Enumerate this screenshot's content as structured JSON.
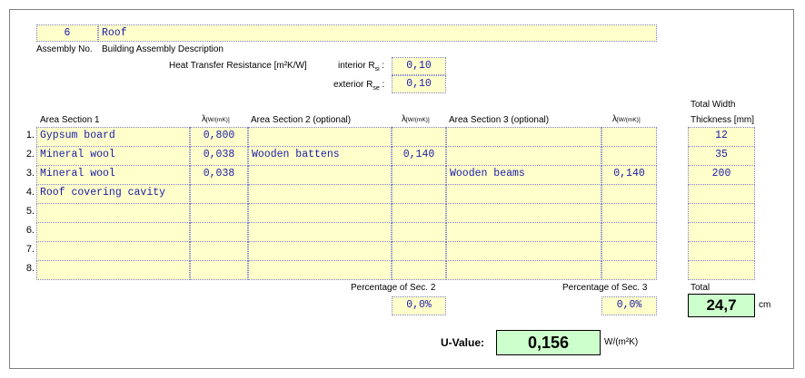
{
  "assembly": {
    "number": "6",
    "description": "Roof",
    "number_label": "Assembly No.",
    "description_label": "Building Assembly Description"
  },
  "heat_transfer": {
    "label": "Heat Transfer Resistance [m²K/W]",
    "interior_label": "interior R",
    "interior_sub": "si",
    "interior_value": "0,10",
    "exterior_label": "exterior R",
    "exterior_sub": "se",
    "exterior_value": "0,10"
  },
  "headers": {
    "area1": "Area Section 1",
    "area2": "Area Section 2 (optional)",
    "area3": "Area Section 3 (optional)",
    "lambda": "λ",
    "lambda_unit": "[W/(mK)]",
    "total_width": "Total Width",
    "thickness": "Thickness [mm]"
  },
  "rows": [
    {
      "num": "1.",
      "m1": "Gypsum board",
      "l1": "0,800",
      "m2": "",
      "l2": "",
      "m3": "",
      "l3": "",
      "thickness": "12"
    },
    {
      "num": "2.",
      "m1": "Mineral wool",
      "l1": "0,038",
      "m2": "Wooden battens",
      "l2": "0,140",
      "m3": "",
      "l3": "",
      "thickness": "35"
    },
    {
      "num": "3.",
      "m1": "Mineral wool",
      "l1": "0,038",
      "m2": "",
      "l2": "",
      "m3": "Wooden beams",
      "l3": "0,140",
      "thickness": "200"
    },
    {
      "num": "4.",
      "m1": "Roof covering cavity",
      "l1": "",
      "m2": "",
      "l2": "",
      "m3": "",
      "l3": "",
      "thickness": ""
    },
    {
      "num": "5.",
      "m1": "",
      "l1": "",
      "m2": "",
      "l2": "",
      "m3": "",
      "l3": "",
      "thickness": ""
    },
    {
      "num": "6.",
      "m1": "",
      "l1": "",
      "m2": "",
      "l2": "",
      "m3": "",
      "l3": "",
      "thickness": ""
    },
    {
      "num": "7.",
      "m1": "",
      "l1": "",
      "m2": "",
      "l2": "",
      "m3": "",
      "l3": "",
      "thickness": ""
    },
    {
      "num": "8.",
      "m1": "",
      "l1": "",
      "m2": "",
      "l2": "",
      "m3": "",
      "l3": "",
      "thickness": ""
    }
  ],
  "percentages": {
    "sec2_label": "Percentage of Sec. 2",
    "sec2_value": "0,0%",
    "sec3_label": "Percentage of Sec. 3",
    "sec3_value": "0,0%"
  },
  "total": {
    "label": "Total",
    "value": "24,7",
    "unit": "cm"
  },
  "uvalue": {
    "label": "U-Value:",
    "value": "0,156",
    "unit": "W/(m²K)"
  }
}
